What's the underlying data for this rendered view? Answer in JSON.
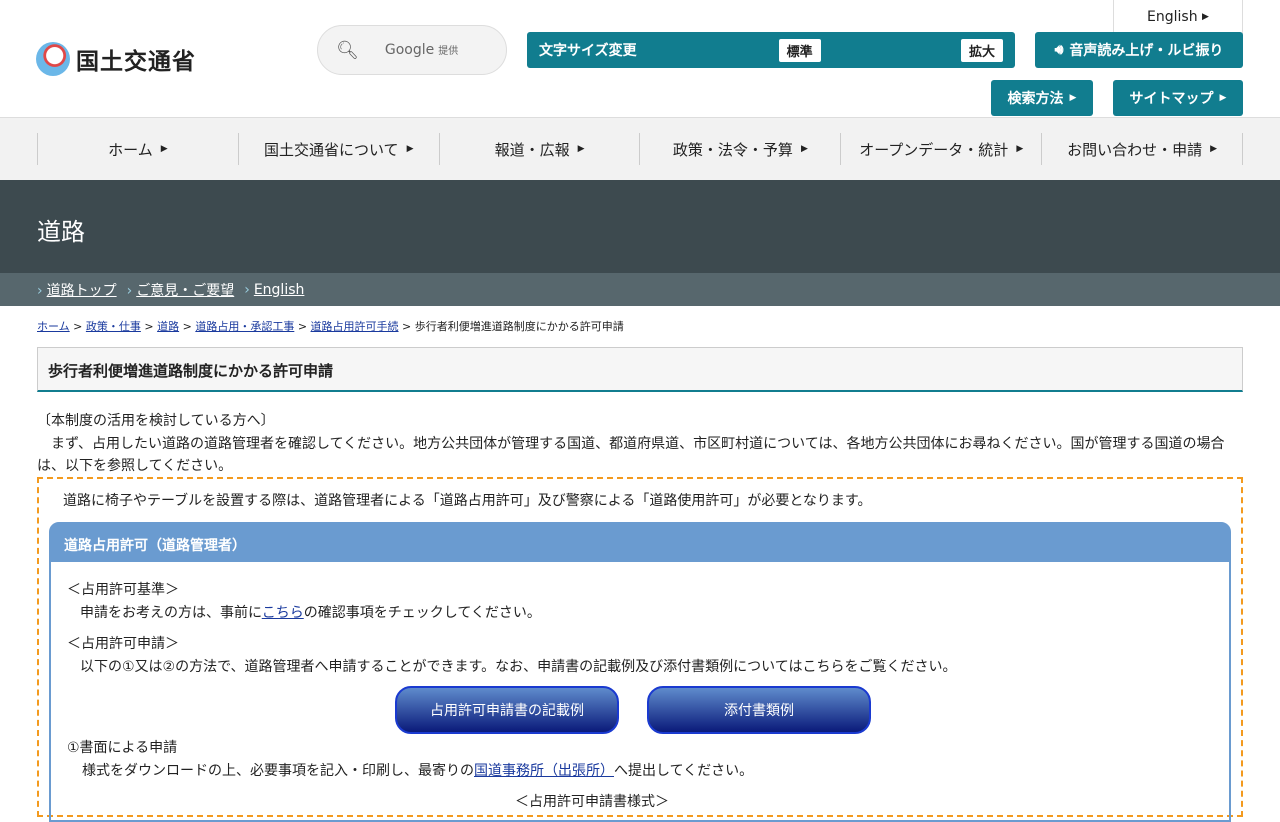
{
  "header": {
    "logo_text": "国土交通省",
    "search": {
      "provider": "Google",
      "provided": "提供"
    },
    "font_size": {
      "label": "文字サイズ変更",
      "standard": "標準",
      "large": "拡大"
    },
    "english": "English",
    "voice": "音声読み上げ・ルビ振り",
    "search_method": "検索方法",
    "sitemap": "サイトマップ"
  },
  "nav": [
    "ホーム",
    "国土交通省について",
    "報道・広報",
    "政策・法令・予算",
    "オープンデータ・統計",
    "お問い合わせ・申請"
  ],
  "section": {
    "title": "道路",
    "links": [
      "道路トップ",
      "ご意見・ご要望",
      "English"
    ]
  },
  "breadcrumb": {
    "links": [
      "ホーム",
      "政策・仕事",
      "道路",
      "道路占用・承認工事",
      "道路占用許可手続"
    ],
    "current": "歩行者利便増進道路制度にかかる許可申請"
  },
  "page": {
    "title": "歩行者利便増進道路制度にかかる許可申請",
    "intro_heading": "〔本制度の活用を検討している方へ〕",
    "intro": "　まず、占用したい道路の道路管理者を確認してください。地方公共団体が管理する国道、都道府県道、市区町村道については、各地方公共団体にお尋ねください。国が管理する国道の場合は、以下を参照してください。",
    "notice": "道路に椅子やテーブルを設置する際は、道路管理者による「道路占用許可」及び警察による「道路使用許可」が必要となります。",
    "panel": {
      "title": "道路占用許可（道路管理者）",
      "criteria_heading": "＜占用許可基準＞",
      "criteria_pre": "申請をお考えの方は、事前に",
      "criteria_link": "こちら",
      "criteria_post": "の確認事項をチェックしてください。",
      "apply_heading": "＜占用許可申請＞",
      "apply_text": "以下の①又は②の方法で、道路管理者へ申請することができます。なお、申請書の記載例及び添付書類例についてはこちらをご覧ください。",
      "buttons": [
        "占用許可申請書の記載例",
        "添付書類例"
      ],
      "paper_heading": "①書面による申請",
      "paper_pre": "様式をダウンロードの上、必要事項を記入・印刷し、最寄りの",
      "paper_link": "国道事務所（出張所）",
      "paper_post": "へ提出してください。",
      "forms_heading": "＜占用許可申請書様式＞"
    }
  }
}
